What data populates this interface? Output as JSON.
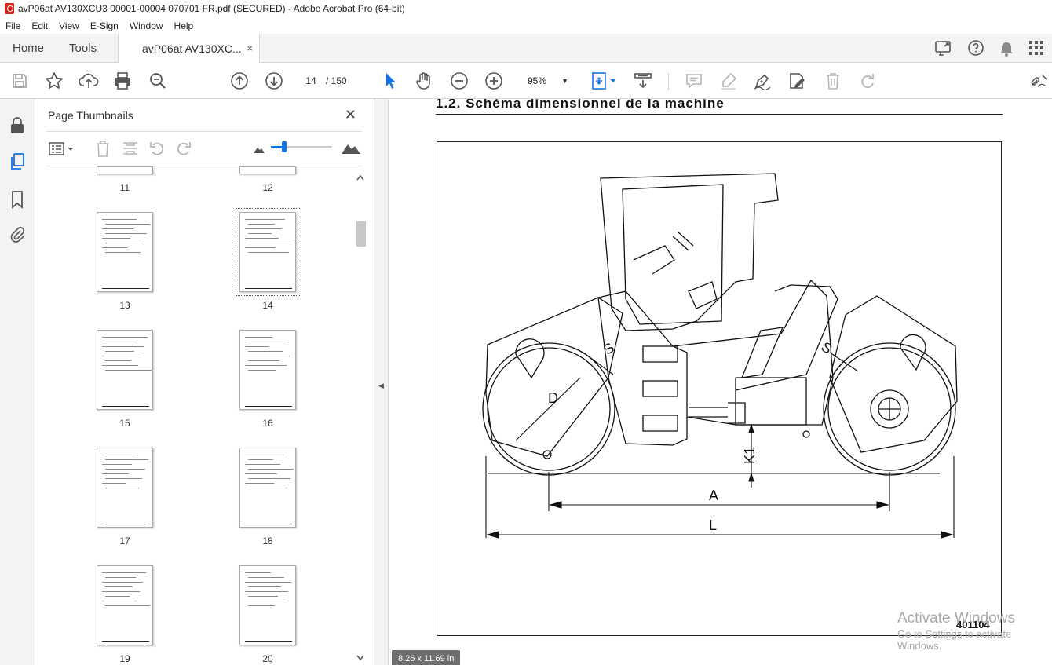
{
  "window": {
    "title": "avP06at AV130XCU3 00001-00004 070701 FR.pdf (SECURED) - Adobe Acrobat Pro (64-bit)"
  },
  "menu": [
    "File",
    "Edit",
    "View",
    "E-Sign",
    "Window",
    "Help"
  ],
  "tabs": {
    "home": "Home",
    "tools": "Tools",
    "document": "avP06at AV130XC...",
    "close": "×"
  },
  "toolbar": {
    "page_current": "14",
    "page_total": "/ 150",
    "zoom": "95%"
  },
  "panel": {
    "title": "Page Thumbnails",
    "thumbnails": [
      {
        "page": "11"
      },
      {
        "page": "12"
      },
      {
        "page": "13"
      },
      {
        "page": "14",
        "selected": true
      },
      {
        "page": "15"
      },
      {
        "page": "16"
      },
      {
        "page": "17"
      },
      {
        "page": "18"
      },
      {
        "page": "19"
      },
      {
        "page": "20"
      }
    ]
  },
  "document": {
    "heading": "1.2.   Schéma dimensionnel de la machine",
    "figure_labels": {
      "S_left": "S",
      "S_right": "S",
      "D": "D",
      "K1": "K1",
      "A": "A",
      "L": "L"
    },
    "figure_number": "401104",
    "page_size": "8.26 x 11.69 in"
  },
  "watermark": {
    "line1": "Activate Windows",
    "line2": "Go to Settings to activate Windows."
  },
  "colors": {
    "accent": "#1473e6",
    "pdf_red": "#d9241b"
  }
}
